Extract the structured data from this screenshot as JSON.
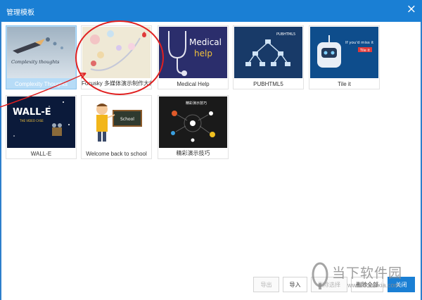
{
  "window": {
    "title": "管理模板",
    "close_icon": "close-icon"
  },
  "templates": [
    {
      "label": "Complexity Thoughts",
      "thumb_text": "Complexity thoughts",
      "selected": true
    },
    {
      "label": "Focusky 多媒体演示制作大师",
      "selected": false
    },
    {
      "label": "Medical Help",
      "thumb_text_1": "Medical",
      "thumb_text_2": "help",
      "selected": false
    },
    {
      "label": "PUBHTML5",
      "thumb_text": "PUBHTML5",
      "selected": false
    },
    {
      "label": "Tile it",
      "thumb_text_1": "If you'd miss it",
      "thumb_text_2": "Tile it",
      "selected": false
    },
    {
      "label": "WALL-E",
      "thumb_text_1": "WALL-E",
      "thumb_text_2": "THE VIDEO CASE",
      "selected": false
    },
    {
      "label": "Welcome back to school",
      "thumb_text": "School",
      "selected": false
    },
    {
      "label": "精彩演示技巧",
      "thumb_text": "精彩演示技巧",
      "selected": false
    }
  ],
  "footer": {
    "export_label": "导出",
    "import_label": "导入",
    "delete_selected_label": "删除选择",
    "delete_all_label": "删除全部",
    "close_label": "关闭"
  },
  "watermark": {
    "text": "当下软件园",
    "url": "www.downxia.com"
  },
  "colors": {
    "accent": "#1a7fd4",
    "annotation": "#e02020"
  }
}
